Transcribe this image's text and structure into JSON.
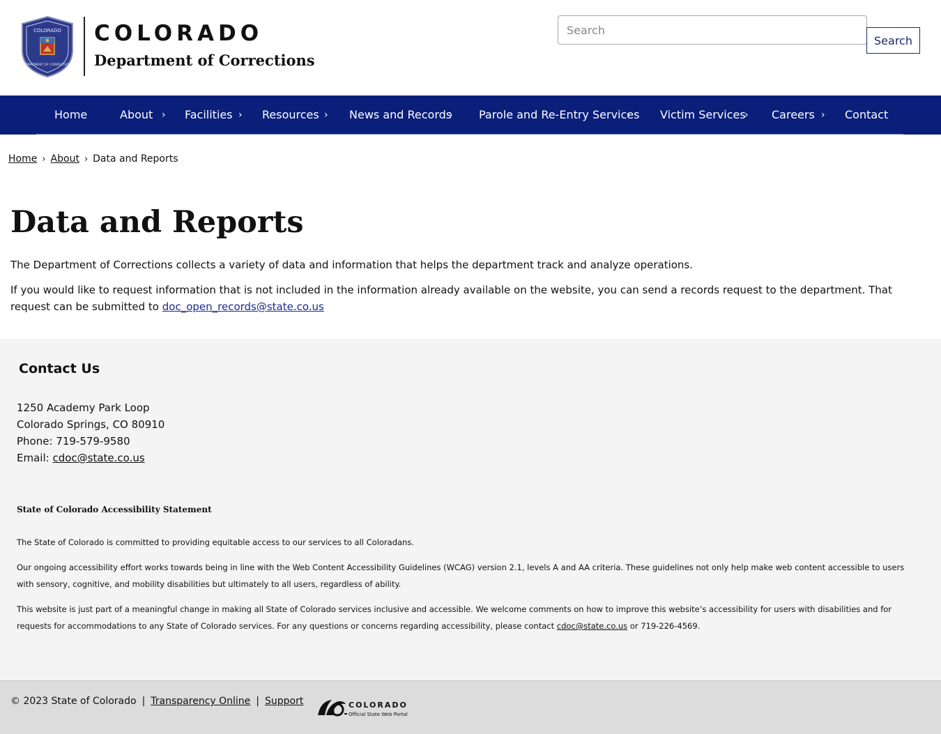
{
  "header": {
    "brand_title": "COLORADO",
    "brand_subtitle": "Department of Corrections",
    "seal_text": [
      "COLORADO",
      "DEPARTMENT OF CORRECTIONS"
    ],
    "search_placeholder": "Search",
    "search_button": "Search"
  },
  "nav": {
    "items": [
      {
        "label": "Home"
      },
      {
        "label": "About"
      },
      {
        "label": "Facilities"
      },
      {
        "label": "Resources"
      },
      {
        "label": "News and Records"
      },
      {
        "label": "Parole and Re-Entry Services"
      },
      {
        "label": "Victim Services"
      },
      {
        "label": "Careers"
      },
      {
        "label": "Contact"
      }
    ],
    "chevron": "›"
  },
  "breadcrumb": {
    "items": [
      "Home",
      "About",
      "Data and Reports"
    ],
    "separator": "›"
  },
  "main": {
    "title": "Data and Reports",
    "intro": "The Department of Corrections collects a variety of data and information that helps the department track and analyze operations.",
    "request_text": "If you would like to request information that is not included in the information already available on the website, you can send a records request to the department. That request can be submitted to ",
    "request_email": "doc_open_records@state.co.us"
  },
  "contact": {
    "heading": "Contact Us",
    "address_line1": "1250 Academy Park Loop",
    "address_line2": "Colorado Springs, CO 80910",
    "phone": "Phone: 719-579-9580",
    "email_label": "Email: ",
    "email": "cdoc@state.co.us"
  },
  "accessibility": {
    "heading": "State of Colorado Accessibility Statement",
    "p1": "The State of Colorado is committed to providing equitable access to our services to all Coloradans.",
    "p2": "Our ongoing accessibility effort works towards being in line with the Web Content Accessibility Guidelines (WCAG) version 2.1, levels A and AA criteria. These guidelines not only help make web content accessible to users with sensory, cognitive, and mobility disabilities but ultimately to all users, regardless of ability.",
    "p3": "This website is just part of a meaningful change in making all State of Colorado services inclusive and accessible. We welcome comments on how to improve this website’s accessibility for users with disabilities and for requests for accommodations to any State of Colorado services. For any questions or concerns regarding accessibility, please contact ",
    "p3_email": "cdoc@state.co.us",
    "p3_end": " or 719-226-4569."
  },
  "footer": {
    "copyright": "© 2023 State of Colorado",
    "separator": "|",
    "links": [
      "Transparency Online",
      "Support"
    ],
    "portal_title": "COLORADO",
    "portal_subtitle": "Official State Web Portal"
  },
  "colors": {
    "nav_bg": "#0a1f7a",
    "link": "#1a2a8a",
    "footer_bg": "#f4f4f4",
    "bottom_bar_bg": "#dcdcdc"
  }
}
